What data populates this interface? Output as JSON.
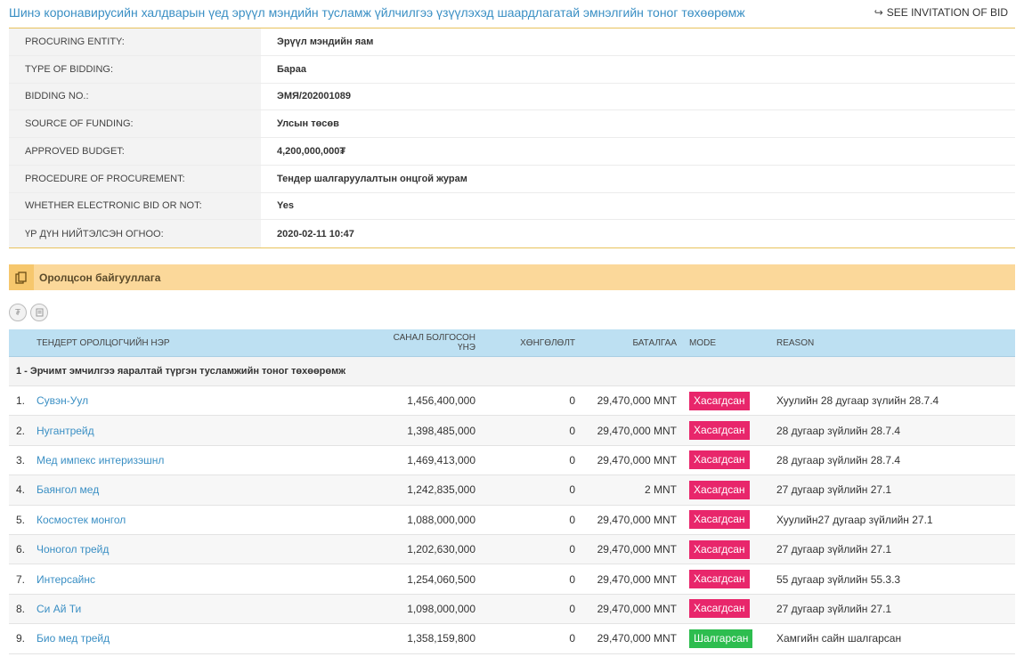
{
  "page": {
    "title": "Шинэ коронавирусийн халдварын үед эрүүл мэндийн тусламж үйлчилгээ үзүүлэхэд шаардлагатай эмнэлгийн тоног төхөөрөмж",
    "see_invitation_label": "SEE INVITATION OF BID",
    "see_invitation_icon": "external-link-icon"
  },
  "info": [
    {
      "label": "PROCURING ENTITY:",
      "value": "Эрүүл мэндийн яам"
    },
    {
      "label": "TYPE OF BIDDING:",
      "value": "Бараа"
    },
    {
      "label": "BIDDING NO.:",
      "value": "ЭМЯ/202001089"
    },
    {
      "label": "SOURCE OF FUNDING:",
      "value": "Улсын төсөв"
    },
    {
      "label": "APPROVED BUDGET:",
      "value": "4,200,000,000₮"
    },
    {
      "label": "PROCEDURE OF PROCUREMENT:",
      "value": "Тендер шалгаруулалтын онцгой журам"
    },
    {
      "label": "WHETHER ELECTRONIC BID OR NOT:",
      "value": "Yes"
    },
    {
      "label": "ҮР ДҮН НИЙТЭЛСЭН ОГНОО:",
      "value": "2020-02-11 10:47"
    }
  ],
  "section": {
    "title": "Оролцсон байгууллага",
    "icon": "copy-icon"
  },
  "toolbar_icons": [
    "currency-icon",
    "document-icon"
  ],
  "table": {
    "headers": {
      "name": "ТЕНДЕРТ ОРОЛЦОГЧИЙН НЭР",
      "price": "САНАЛ БОЛГОСОН ҮНЭ",
      "discount": "ХӨНГӨЛӨЛТ",
      "guarantee": "БАТАЛГАА",
      "mode": "MODE",
      "reason": "REASON"
    },
    "group": "1 - Эрчимт эмчилгээ яаралтай түргэн тусламжийн тоног төхөөрөмж",
    "rows": [
      {
        "num": "1.",
        "name": "Сувэн-Уул",
        "price": "1,456,400,000",
        "discount": "0",
        "guarantee": "29,470,000 MNT",
        "mode": "Хасагдсан",
        "status": "rejected",
        "reason": "Хуулийн 28 дугаар зүлийн 28.7.4"
      },
      {
        "num": "2.",
        "name": "Нугантрейд",
        "price": "1,398,485,000",
        "discount": "0",
        "guarantee": "29,470,000 MNT",
        "mode": "Хасагдсан",
        "status": "rejected",
        "reason": "28 дугаар зүйлийн 28.7.4"
      },
      {
        "num": "3.",
        "name": "Мед импекс интеризэшнл",
        "price": "1,469,413,000",
        "discount": "0",
        "guarantee": "29,470,000 MNT",
        "mode": "Хасагдсан",
        "status": "rejected",
        "reason": "28 дугаар зүйлийн 28.7.4"
      },
      {
        "num": "4.",
        "name": "Баянгол мед",
        "price": "1,242,835,000",
        "discount": "0",
        "guarantee": "2 MNT",
        "mode": "Хасагдсан",
        "status": "rejected",
        "reason": "27 дугаар зүйлийн 27.1"
      },
      {
        "num": "5.",
        "name": "Космостек монгол",
        "price": "1,088,000,000",
        "discount": "0",
        "guarantee": "29,470,000 MNT",
        "mode": "Хасагдсан",
        "status": "rejected",
        "reason": "Хуулийн27 дугаар зүйлийн 27.1"
      },
      {
        "num": "6.",
        "name": "Чоногол трейд",
        "price": "1,202,630,000",
        "discount": "0",
        "guarantee": "29,470,000 MNT",
        "mode": "Хасагдсан",
        "status": "rejected",
        "reason": "27 дугаар зүйлийн 27.1"
      },
      {
        "num": "7.",
        "name": "Интерсайнс",
        "price": "1,254,060,500",
        "discount": "0",
        "guarantee": "29,470,000 MNT",
        "mode": "Хасагдсан",
        "status": "rejected",
        "reason": "55 дугаар зүйлийн 55.3.3"
      },
      {
        "num": "8.",
        "name": "Си Ай Ти",
        "price": "1,098,000,000",
        "discount": "0",
        "guarantee": "29,470,000 MNT",
        "mode": "Хасагдсан",
        "status": "rejected",
        "reason": "27 дугаар зүйлийн 27.1"
      },
      {
        "num": "9.",
        "name": "Био мед трейд",
        "price": "1,358,159,800",
        "discount": "0",
        "guarantee": "29,470,000 MNT",
        "mode": "Шалгарсан",
        "status": "selected",
        "reason": "Хамгийн сайн шалгарсан"
      }
    ]
  }
}
